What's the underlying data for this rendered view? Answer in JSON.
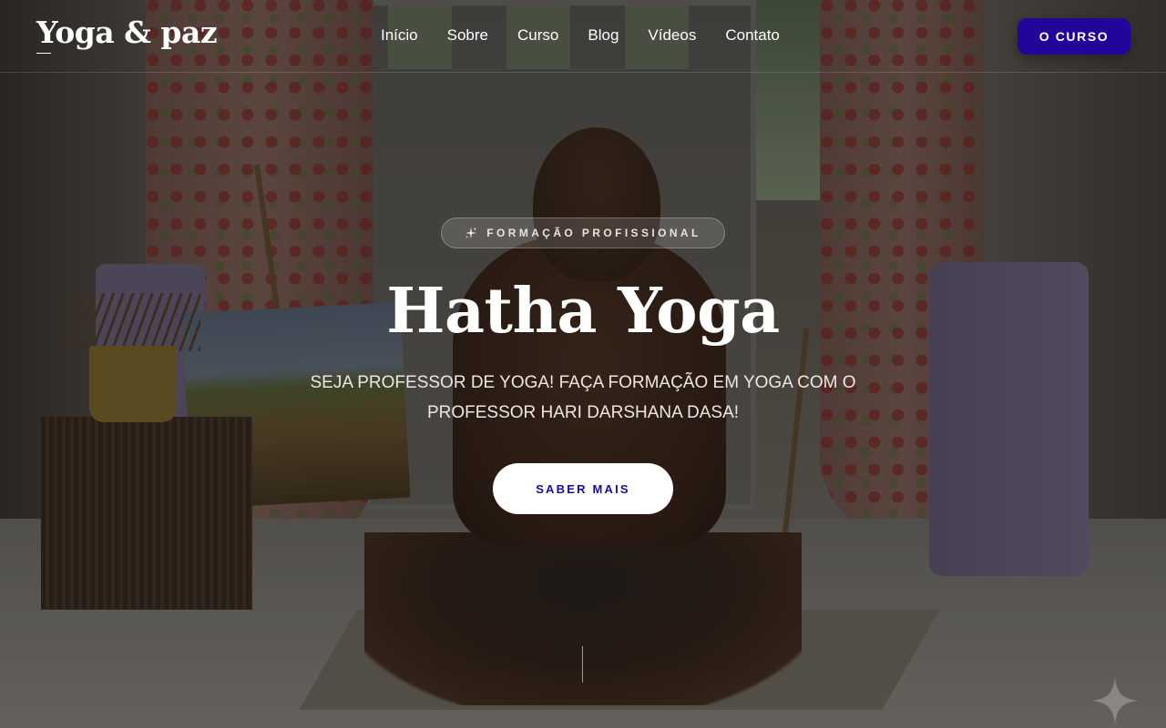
{
  "brand": {
    "logo": "Yoga & paz"
  },
  "nav": {
    "items": [
      {
        "label": "Início"
      },
      {
        "label": "Sobre"
      },
      {
        "label": "Curso"
      },
      {
        "label": "Blog"
      },
      {
        "label": "Vídeos"
      },
      {
        "label": "Contato"
      }
    ]
  },
  "header": {
    "cta_label": "O CURSO"
  },
  "hero": {
    "badge": "FORMAÇÃO PROFISSIONAL",
    "badge_icon": "sparkle-icon",
    "title": "Hatha Yoga",
    "subtitle": "SEJA PROFESSOR DE YOGA! FAÇA FORMAÇÃO EM YOGA COM O PROFESSOR HARI DARSHANA DASA!",
    "cta_label": "SABER MAIS"
  },
  "colors": {
    "accent": "#22069c",
    "text": "#ffffff"
  }
}
